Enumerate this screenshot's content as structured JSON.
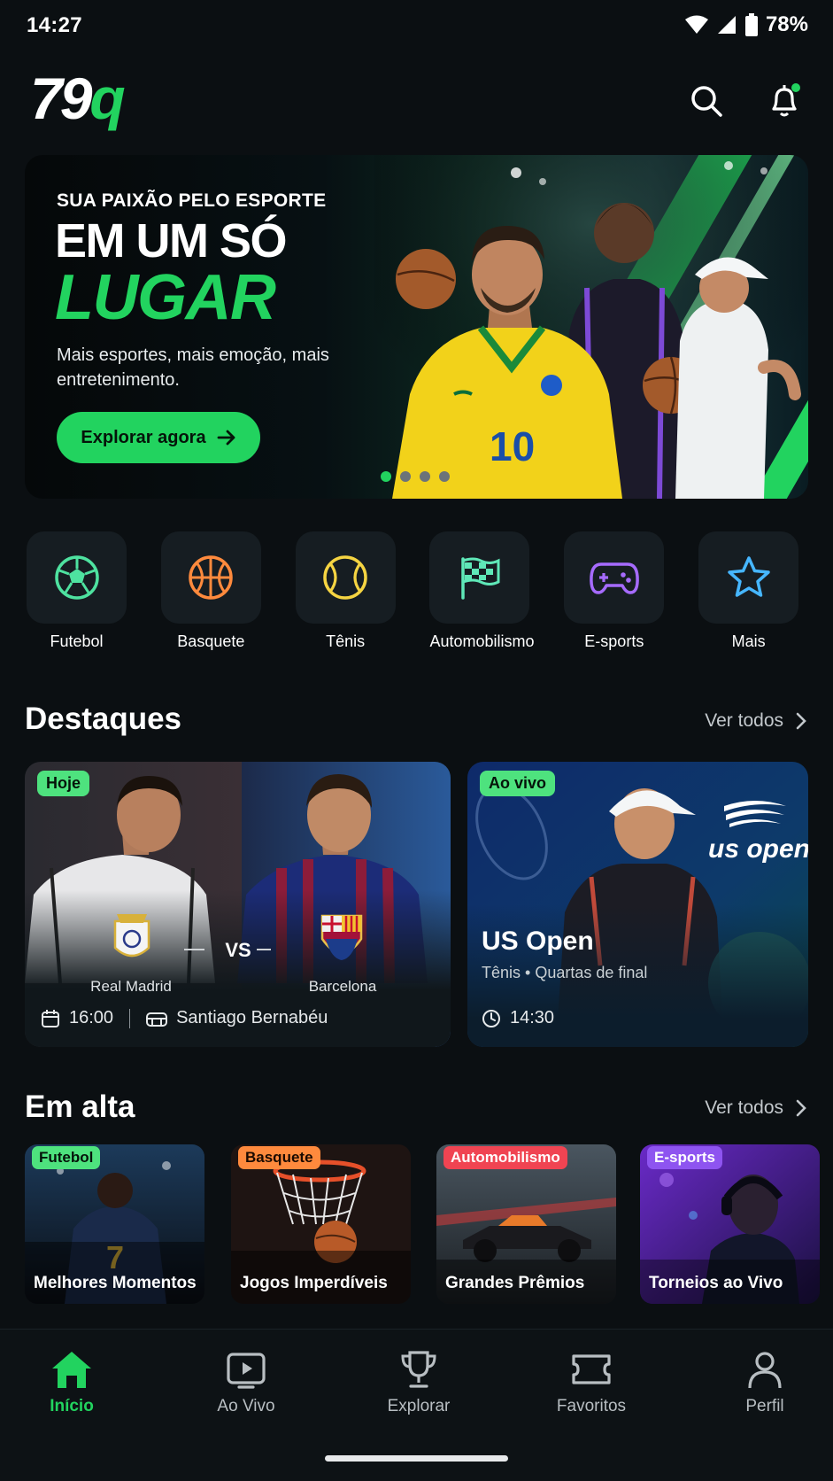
{
  "status": {
    "time": "14:27",
    "battery": "78%"
  },
  "brand": {
    "logo_main": "79",
    "logo_accent": "q",
    "accent_color": "#22d35f"
  },
  "hero": {
    "kicker": "SUA PAIXÃO PELO ESPORTE",
    "title_line1": "EM UM SÓ",
    "title_line2": "LUGAR",
    "subtitle": "Mais esportes, mais emoção, mais entretenimento.",
    "cta_label": "Explorar agora",
    "jersey_number": "10",
    "slides": 4,
    "active_slide": 1
  },
  "categories": [
    {
      "label": "Futebol",
      "icon": "soccer-ball-icon",
      "color": "#4ee2a0"
    },
    {
      "label": "Basquete",
      "icon": "basketball-icon",
      "color": "#ff8a3d"
    },
    {
      "label": "Tênis",
      "icon": "tennis-ball-icon",
      "color": "#f5d442"
    },
    {
      "label": "Automobilismo",
      "icon": "checkered-flag-icon",
      "color": "#5fe8b8"
    },
    {
      "label": "E-sports",
      "icon": "gamepad-icon",
      "color": "#a66bff"
    },
    {
      "label": "Mais",
      "icon": "star-icon",
      "color": "#46b6ff"
    }
  ],
  "highlights": {
    "title": "Destaques",
    "see_all": "Ver todos",
    "match": {
      "badge": "Hoje",
      "home": "Real Madrid",
      "away": "Barcelona",
      "vs": "VS",
      "time": "16:00",
      "venue": "Santiago Bernabéu"
    },
    "event": {
      "badge": "Ao vivo",
      "brand": "us open",
      "title": "US Open",
      "subtitle": "Tênis • Quartas de final",
      "time": "14:30"
    }
  },
  "trending": {
    "title": "Em alta",
    "see_all": "Ver todos",
    "tiles": [
      {
        "badge": "Futebol",
        "label": "Melhores Momentos",
        "badge_color": "#4ee27e",
        "badge_text": "#05140a"
      },
      {
        "badge": "Basquete",
        "label": "Jogos Imperdíveis",
        "badge_color": "#ff8a3d",
        "badge_text": "#1a0a00"
      },
      {
        "badge": "Automobilismo",
        "label": "Grandes Prêmios",
        "badge_color": "#f04452",
        "badge_text": "#ffffff"
      },
      {
        "badge": "E-sports",
        "label": "Torneios ao Vivo",
        "badge_color": "#8e54f0",
        "badge_text": "#ffffff"
      }
    ],
    "tile_jersey": "7"
  },
  "nav": [
    {
      "label": "Início",
      "icon": "home-icon",
      "active": true
    },
    {
      "label": "Ao Vivo",
      "icon": "live-tv-icon",
      "active": false
    },
    {
      "label": "Explorar",
      "icon": "trophy-icon",
      "active": false
    },
    {
      "label": "Favoritos",
      "icon": "ticket-icon",
      "active": false
    },
    {
      "label": "Perfil",
      "icon": "user-icon",
      "active": false
    }
  ]
}
